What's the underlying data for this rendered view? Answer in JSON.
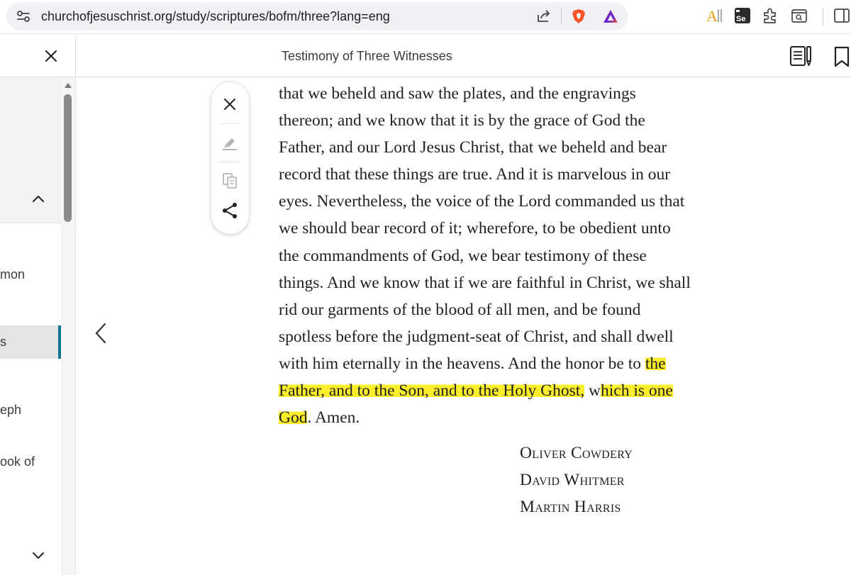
{
  "browser": {
    "url": "churchofjesuschrist.org/study/scriptures/bofm/three?lang=eng"
  },
  "header": {
    "title": "Testimony of Three Witnesses"
  },
  "sidebar": {
    "items": [
      {
        "label": "mon"
      },
      {
        "label": "s",
        "active": true
      },
      {
        "label": "eph"
      },
      {
        "label": "ook of"
      }
    ],
    "accent_color": "#157493"
  },
  "content": {
    "lines": [
      [
        {
          "text": "that we beheld and saw the plates, and the engravings"
        }
      ],
      [
        {
          "text": "thereon; and we know that it is by the grace of God the"
        }
      ],
      [
        {
          "text": "Father, and our Lord Jesus Christ, that we beheld and bear"
        }
      ],
      [
        {
          "text": "record that these things are true. And it is marvelous in our"
        }
      ],
      [
        {
          "text": "eyes. Nevertheless, the voice of the Lord commanded us that"
        }
      ],
      [
        {
          "text": "we should bear record of it; wherefore, to be obedient unto"
        }
      ],
      [
        {
          "text": "the commandments of God, we bear testimony of these"
        }
      ],
      [
        {
          "text": "things. And we know that if we are faithful in Christ, we shall"
        }
      ],
      [
        {
          "text": "rid our garments of the blood of all men, and be found"
        }
      ],
      [
        {
          "text": "spotless before the judgment-seat of Christ, and shall dwell"
        }
      ],
      [
        {
          "text": "with him eternally in the heavens. And the honor be to "
        },
        {
          "text": "the",
          "hl": true
        }
      ],
      [
        {
          "text": "Father, and to the Son, and to the Holy Ghost,",
          "hl": true
        },
        {
          "text": " w"
        },
        {
          "text": "hich is one",
          "hl": true
        }
      ],
      [
        {
          "text": "God",
          "hl": true
        },
        {
          "text": ". Amen."
        }
      ]
    ],
    "highlight_color": "#fcee2a",
    "witnesses": [
      "Oliver Cowdery",
      "David Whitmer",
      "Martin Harris"
    ]
  }
}
